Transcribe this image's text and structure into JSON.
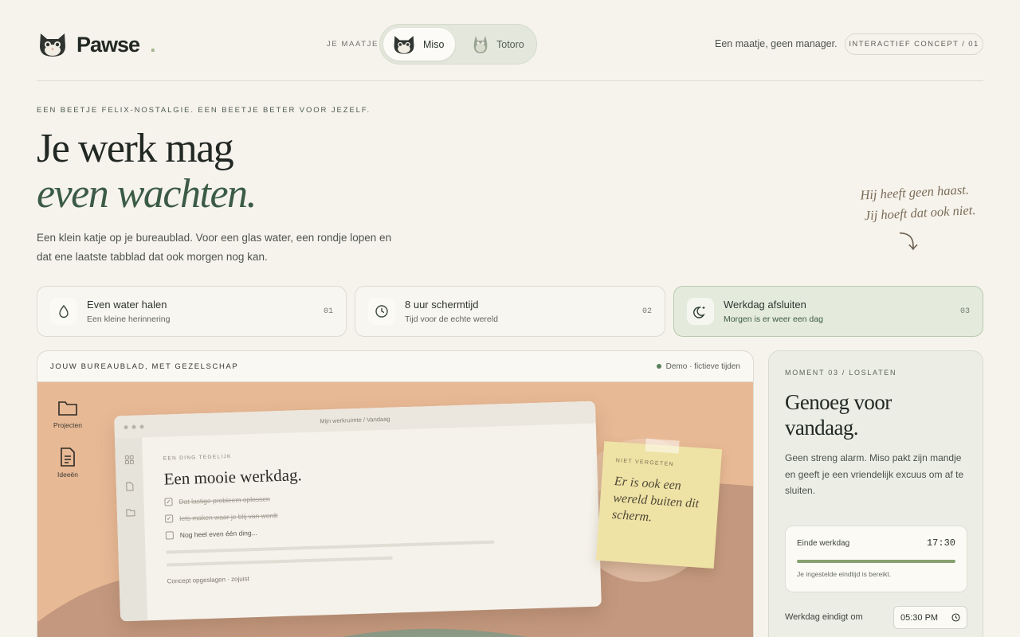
{
  "brand": {
    "name": "Pawse",
    "dot": "."
  },
  "maatje": {
    "label": "JE MAATJE",
    "options": [
      {
        "label": "Miso",
        "icon": "cat-face-icon",
        "selected": true
      },
      {
        "label": "Totoro",
        "icon": "totoro-icon",
        "selected": false
      }
    ]
  },
  "header": {
    "tagline": "Een maatje, geen manager.",
    "concept": "INTERACTIEF CONCEPT / 01"
  },
  "hero": {
    "eyebrow": "EEN BEETJE FELIX-NOSTALGIE. EEN BEETJE BETER VOOR JEZELF.",
    "line1": "Je werk mag",
    "line2": "even wachten.",
    "body": "Een klein katje op je bureaublad. Voor een glas water, een rondje lopen en dat ene laatste tabblad dat ook morgen nog kan.",
    "note_line1": "Hij heeft geen haast.",
    "note_line2": "Jij hoeft dat ook niet.",
    "note_arrow": "⤵"
  },
  "moments": [
    {
      "title": "Even water halen",
      "sub": "Een kleine herinnering",
      "num": "01",
      "icon": "water-drop-icon",
      "active": false
    },
    {
      "title": "8 uur schermtijd",
      "sub": "Tijd voor de echte wereld",
      "num": "02",
      "icon": "clock-icon",
      "active": false
    },
    {
      "title": "Werkdag afsluiten",
      "sub": "Morgen is er weer een dag",
      "num": "03",
      "icon": "moon-icon",
      "active": true
    }
  ],
  "desktop": {
    "title": "JOUW BUREAUBLAD, MET GEZELSCHAP",
    "demo": "Demo · fictieve tijden",
    "icons": [
      {
        "label": "Projecten",
        "icon": "folder-icon"
      },
      {
        "label": "Ideeën",
        "icon": "document-icon"
      }
    ],
    "window": {
      "crumb": "Mijn werkruimte   /   Vandaag",
      "eyebrow": "EEN DING TEGELIJK",
      "heading": "Een mooie werkdag.",
      "tasks": [
        {
          "text": "Dat lastige probleem oplossen",
          "done": true
        },
        {
          "text": "Iets maken waar je blij van wordt",
          "done": true
        },
        {
          "text": "Nog heel even één ding...",
          "done": false
        }
      ],
      "saved": "Concept opgeslagen · zojuist"
    },
    "sticky": {
      "label": "NIET VERGETEN",
      "text": "Er is ook een wereld buiten dit scherm."
    }
  },
  "panel": {
    "eyebrow": "MOMENT 03 / LOSLATEN",
    "heading": "Genoeg voor vandaag.",
    "body": "Geen streng alarm. Miso pakt zijn mandje en geeft je een vriendelijk excuus om af te sluiten.",
    "end_label": "Einde werkdag",
    "end_time": "17:30",
    "progress": 1.0,
    "note": "Je ingestelde eindtijd is bereikt.",
    "input_label": "Werkdag eindigt om",
    "input_value": "05:30 PM"
  },
  "colors": {
    "accent": "#3b5b45",
    "progress": "#86a06f",
    "desk": "#e8b995",
    "sticky": "#efe2a5"
  }
}
